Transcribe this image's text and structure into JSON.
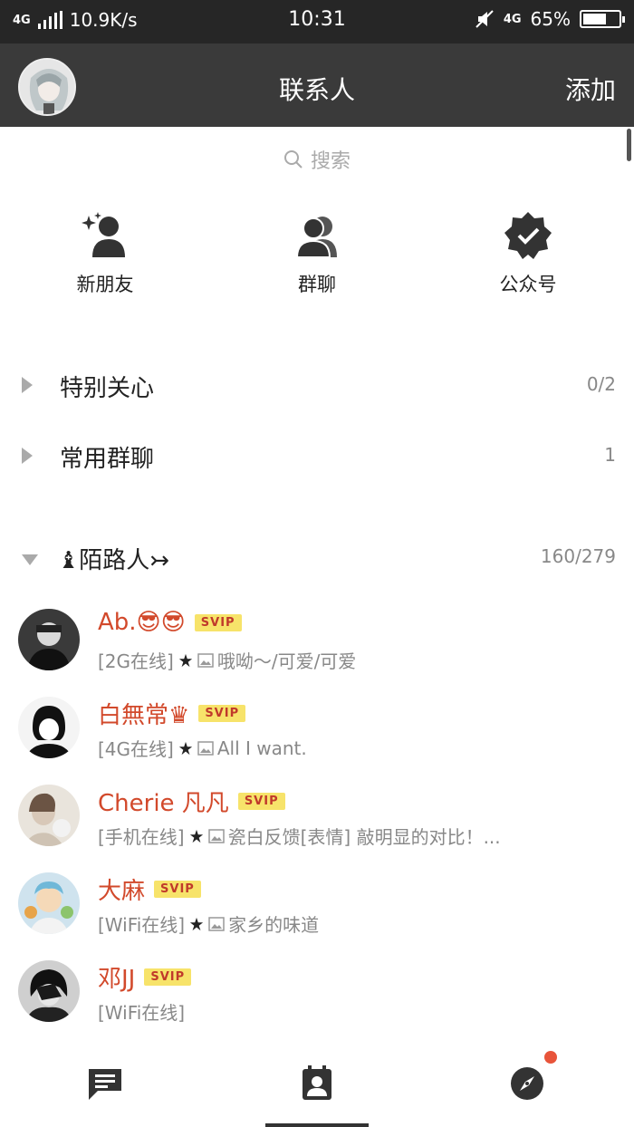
{
  "status_bar": {
    "network": "4G",
    "speed": "10.9K/s",
    "time": "10:31",
    "data_network": "4G",
    "battery": "65%",
    "battery_level": 0.65
  },
  "header": {
    "title": "联系人",
    "add_label": "添加"
  },
  "search": {
    "placeholder": "搜索"
  },
  "quick_entries": [
    {
      "label": "新朋友",
      "icon": "add-friend-icon"
    },
    {
      "label": "群聊",
      "icon": "group-chat-icon"
    },
    {
      "label": "公众号",
      "icon": "official-account-icon"
    }
  ],
  "groups": [
    {
      "name": "特别关心",
      "count": "0/2",
      "expanded": false
    },
    {
      "name": "常用群聊",
      "count": "1",
      "expanded": false
    },
    {
      "name": "♝陌路人↣",
      "count": "160/279",
      "expanded": true
    }
  ],
  "contacts": [
    {
      "name": "Ab.😎😎",
      "badge": "SVIP",
      "status": "[2G在线]",
      "message": "哦呦～/可爱/可爱"
    },
    {
      "name": "白無常♛",
      "badge": "SVIP",
      "status": "[4G在线]",
      "message": "All I want."
    },
    {
      "name": "Cherie 凡凡",
      "badge": "SVIP",
      "status": "[手机在线]",
      "message": "瓷白反馈[表情] 敲明显的对比！..."
    },
    {
      "name": "大麻",
      "badge": "SVIP",
      "status": "[WiFi在线]",
      "message": "家乡的味道"
    },
    {
      "name": "邓JJ",
      "badge": "SVIP",
      "status": "[WiFi在线]",
      "message": ""
    }
  ],
  "bottom_nav": [
    {
      "icon": "messages-icon",
      "active": false
    },
    {
      "icon": "contacts-icon",
      "active": true
    },
    {
      "icon": "discover-icon",
      "active": false,
      "badge_dot": true
    }
  ],
  "colors": {
    "header_bg": "#3a3a3a",
    "status_bg": "#262626",
    "name_color": "#d2492b",
    "svip_bg": "#f7e36a"
  }
}
